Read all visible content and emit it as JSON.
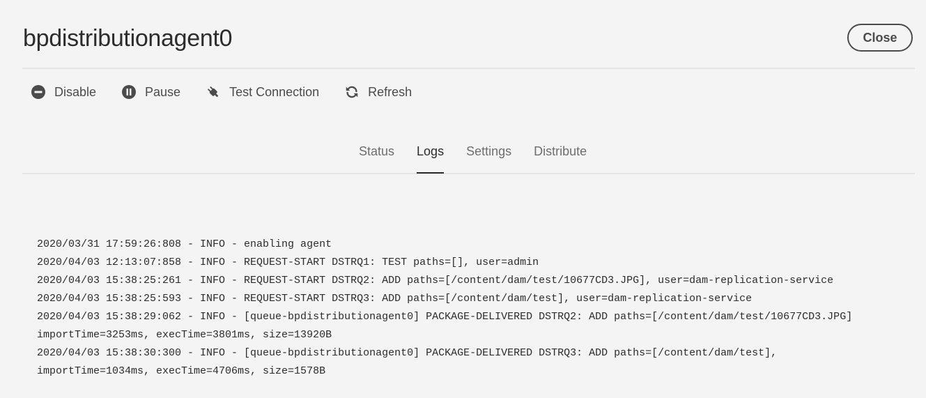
{
  "header": {
    "title": "bpdistributionagent0",
    "close_label": "Close"
  },
  "toolbar": {
    "items": [
      {
        "label": "Disable",
        "icon": "disable-icon"
      },
      {
        "label": "Pause",
        "icon": "pause-icon"
      },
      {
        "label": "Test Connection",
        "icon": "plug-icon"
      },
      {
        "label": "Refresh",
        "icon": "refresh-icon"
      }
    ]
  },
  "tabs": {
    "items": [
      {
        "label": "Status"
      },
      {
        "label": "Logs"
      },
      {
        "label": "Settings"
      },
      {
        "label": "Distribute"
      }
    ],
    "selected": "Logs"
  },
  "logs": {
    "lines": [
      "2020/03/31 17:59:26:808 - INFO - enabling agent",
      "2020/04/03 12:13:07:858 - INFO - REQUEST-START DSTRQ1: TEST paths=[], user=admin",
      "2020/04/03 15:38:25:261 - INFO - REQUEST-START DSTRQ2: ADD paths=[/content/dam/test/10677CD3.JPG], user=dam-replication-service",
      "2020/04/03 15:38:25:593 - INFO - REQUEST-START DSTRQ3: ADD paths=[/content/dam/test], user=dam-replication-service",
      "2020/04/03 15:38:29:062 - INFO - [queue-bpdistributionagent0] PACKAGE-DELIVERED DSTRQ2: ADD paths=[/content/dam/test/10677CD3.JPG]",
      "importTime=3253ms, execTime=3801ms, size=13920B",
      "2020/04/03 15:38:30:300 - INFO - [queue-bpdistributionagent0] PACKAGE-DELIVERED DSTRQ3: ADD paths=[/content/dam/test],",
      "importTime=1034ms, execTime=4706ms, size=1578B"
    ]
  },
  "colors": {
    "background": "#f4f4f4",
    "text": "#2c2c2c",
    "muted_text": "#6e6e6e",
    "icon": "#4b4b4b",
    "divider": "#e4e4e4"
  }
}
